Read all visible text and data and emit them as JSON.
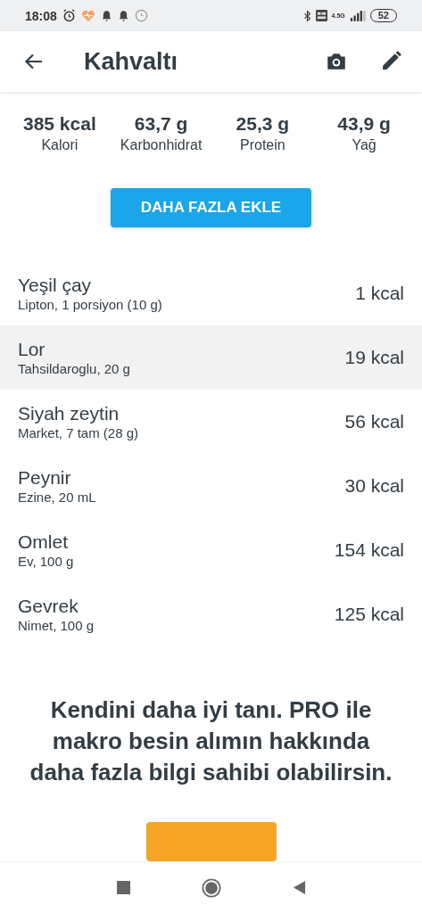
{
  "status_bar": {
    "time": "18:08",
    "network": "4.5G",
    "battery": "52"
  },
  "header": {
    "title": "Kahvaltı"
  },
  "summary": [
    {
      "value": "385 kcal",
      "label": "Kalori"
    },
    {
      "value": "63,7 g",
      "label": "Karbonhidrat"
    },
    {
      "value": "25,3 g",
      "label": "Protein"
    },
    {
      "value": "43,9 g",
      "label": "Yağ"
    }
  ],
  "add_button": "DAHA FAZLA EKLE",
  "foods": [
    {
      "name": "Yeşil çay",
      "detail": "Lipton, 1 porsiyon (10 g)",
      "calories": "1 kcal",
      "selected": false
    },
    {
      "name": "Lor",
      "detail": "Tahsildaroglu, 20 g",
      "calories": "19 kcal",
      "selected": true
    },
    {
      "name": "Siyah zeytin",
      "detail": "Market, 7 tam (28 g)",
      "calories": "56 kcal",
      "selected": false
    },
    {
      "name": "Peynir",
      "detail": "Ezine, 20 mL",
      "calories": "30 kcal",
      "selected": false
    },
    {
      "name": "Omlet",
      "detail": "Ev, 100 g",
      "calories": "154 kcal",
      "selected": false
    },
    {
      "name": "Gevrek",
      "detail": "Nimet, 100 g",
      "calories": "125 kcal",
      "selected": false
    }
  ],
  "promo": {
    "text": "Kendini daha iyi tanı. PRO ile makro besin alımın hakkında daha fazla bilgi sahibi olabilirsin."
  }
}
